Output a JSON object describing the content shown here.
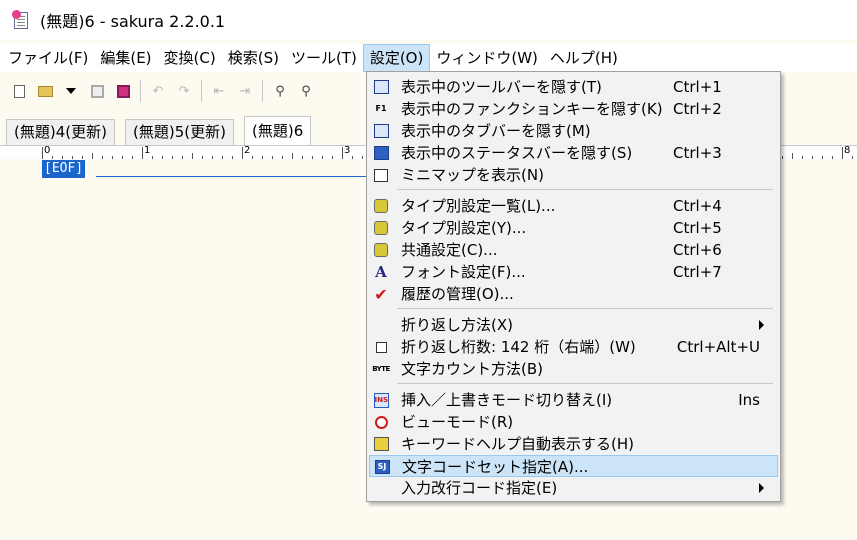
{
  "window": {
    "title": "(無題)6 - sakura 2.2.0.1"
  },
  "menubar": [
    {
      "label": "ファイル(F)"
    },
    {
      "label": "編集(E)"
    },
    {
      "label": "変換(C)"
    },
    {
      "label": "検索(S)"
    },
    {
      "label": "ツール(T)"
    },
    {
      "label": "設定(O)",
      "active": true
    },
    {
      "label": "ウィンドウ(W)"
    },
    {
      "label": "ヘルプ(H)"
    }
  ],
  "toolbar": {
    "icons": [
      "new-file-icon",
      "open-folder-icon",
      "dropdown-arrow-icon",
      "save-icon",
      "save-all-icon",
      "undo-icon",
      "redo-icon",
      "jump-back-icon",
      "jump-forward-icon",
      "search-icon",
      "search-next-icon"
    ],
    "undo_glyph": "↶",
    "redo_glyph": "↷",
    "back_glyph": "⇤",
    "forward_glyph": "⇥",
    "search_glyph": "⚲"
  },
  "tabs": [
    {
      "label": "(無題)4(更新)"
    },
    {
      "label": "(無題)5(更新)"
    },
    {
      "label": "(無題)6",
      "active": true
    }
  ],
  "ruler": {
    "labels": [
      "0",
      "1",
      "2",
      "3",
      "8"
    ]
  },
  "editor": {
    "eof_marker": "[EOF]"
  },
  "settings_menu": {
    "items": [
      {
        "label": "表示中のツールバーを隠す(T)",
        "shortcut": "Ctrl+1",
        "icon": "toolbar-icon"
      },
      {
        "label": "表示中のファンクションキーを隠す(K)",
        "shortcut": "Ctrl+2",
        "icon": "function-key-icon"
      },
      {
        "label": "表示中のタブバーを隠す(M)",
        "shortcut": "",
        "icon": "tabbar-icon"
      },
      {
        "label": "表示中のステータスバーを隠す(S)",
        "shortcut": "Ctrl+3",
        "icon": "statusbar-icon"
      },
      {
        "label": "ミニマップを表示(N)",
        "shortcut": "",
        "icon": "minimap-icon"
      },
      {
        "label": "タイプ別設定一覧(L)...",
        "shortcut": "Ctrl+4",
        "icon": "type-list-icon"
      },
      {
        "label": "タイプ別設定(Y)...",
        "shortcut": "Ctrl+5",
        "icon": "type-settings-icon"
      },
      {
        "label": "共通設定(C)...",
        "shortcut": "Ctrl+6",
        "icon": "common-settings-icon"
      },
      {
        "label": "フォント設定(F)...",
        "shortcut": "Ctrl+7",
        "icon": "font-icon"
      },
      {
        "label": "履歴の管理(O)...",
        "shortcut": "",
        "icon": "history-check-icon"
      },
      {
        "label": "折り返し方法(X)",
        "shortcut": "",
        "icon": "",
        "submenu": true
      },
      {
        "label": "折り返し桁数: 142 桁（右端）(W)",
        "shortcut": "Ctrl+Alt+U",
        "icon": "wrap-width-icon"
      },
      {
        "label": "文字カウント方法(B)",
        "shortcut": "",
        "icon": "byte-count-icon"
      },
      {
        "label": "挿入／上書きモード切り替え(I)",
        "shortcut": "Ins",
        "icon": "insert-mode-icon"
      },
      {
        "label": "ビューモード(R)",
        "shortcut": "",
        "icon": "view-mode-icon"
      },
      {
        "label": "キーワードヘルプ自動表示する(H)",
        "shortcut": "",
        "icon": "keyword-help-icon"
      },
      {
        "label": "文字コードセット指定(A)...",
        "shortcut": "",
        "icon": "charset-icon",
        "highlighted": true
      },
      {
        "label": "入力改行コード指定(E)",
        "shortcut": "",
        "icon": "",
        "submenu": true
      }
    ],
    "icon_text": {
      "fkey": "F1",
      "byte": "BYTE",
      "ins": "INS",
      "font": "A",
      "check": "✔",
      "code": "SJ"
    }
  },
  "colors": {
    "menu_highlight": "#cce4f7",
    "eof_bg": "#1a66cc",
    "editor_bg": "#fdfaf0"
  }
}
